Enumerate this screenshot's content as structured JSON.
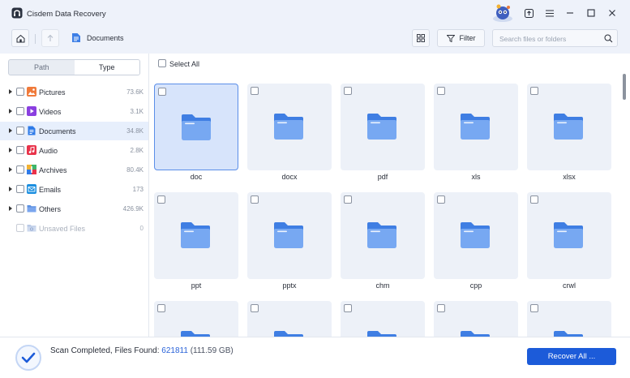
{
  "app": {
    "title": "Cisdem Data Recovery",
    "icons": [
      "app-logo-icon",
      "mascot-icon",
      "upload-icon",
      "menu-icon",
      "minimize-icon",
      "maximize-icon",
      "close-icon"
    ]
  },
  "toolbar": {
    "breadcrumb": "Documents",
    "filter_label": "Filter",
    "search_placeholder": "Search files or folders"
  },
  "sidebar": {
    "tabs": [
      {
        "label": "Path",
        "active": false
      },
      {
        "label": "Type",
        "active": true
      }
    ],
    "categories": [
      {
        "label": "Pictures",
        "count": "73.6K",
        "icon": "pictures-icon",
        "selected": false,
        "disabled": false
      },
      {
        "label": "Videos",
        "count": "3.1K",
        "icon": "videos-icon",
        "selected": false,
        "disabled": false
      },
      {
        "label": "Documents",
        "count": "34.8K",
        "icon": "documents-icon",
        "selected": true,
        "disabled": false
      },
      {
        "label": "Audio",
        "count": "2.8K",
        "icon": "audio-icon",
        "selected": false,
        "disabled": false
      },
      {
        "label": "Archives",
        "count": "80.4K",
        "icon": "archives-icon",
        "selected": false,
        "disabled": false
      },
      {
        "label": "Emails",
        "count": "173",
        "icon": "emails-icon",
        "selected": false,
        "disabled": false
      },
      {
        "label": "Others",
        "count": "426.9K",
        "icon": "others-icon",
        "selected": false,
        "disabled": false
      },
      {
        "label": "Unsaved Files",
        "count": "0",
        "icon": "unsaved-files-icon",
        "selected": false,
        "disabled": true
      }
    ]
  },
  "main": {
    "select_all_label": "Select All",
    "folders": [
      {
        "name": "doc",
        "selected": true
      },
      {
        "name": "docx",
        "selected": false
      },
      {
        "name": "pdf",
        "selected": false
      },
      {
        "name": "xls",
        "selected": false
      },
      {
        "name": "xlsx",
        "selected": false
      },
      {
        "name": "ppt",
        "selected": false
      },
      {
        "name": "pptx",
        "selected": false
      },
      {
        "name": "chm",
        "selected": false
      },
      {
        "name": "cpp",
        "selected": false
      },
      {
        "name": "crwl",
        "selected": false
      },
      {
        "name": "",
        "selected": false
      },
      {
        "name": "",
        "selected": false
      },
      {
        "name": "",
        "selected": false
      },
      {
        "name": "",
        "selected": false
      },
      {
        "name": "",
        "selected": false
      }
    ]
  },
  "footer": {
    "status_prefix": "Scan Completed, Files Found: ",
    "files_found": "621811",
    "total_size": " (111.59 GB)",
    "recover_label": "Recover All ..."
  },
  "colors": {
    "accent": "#1c5bd9",
    "selection": "#e7effc",
    "tile": "#edf1f8",
    "folder": "#4a86e8"
  }
}
